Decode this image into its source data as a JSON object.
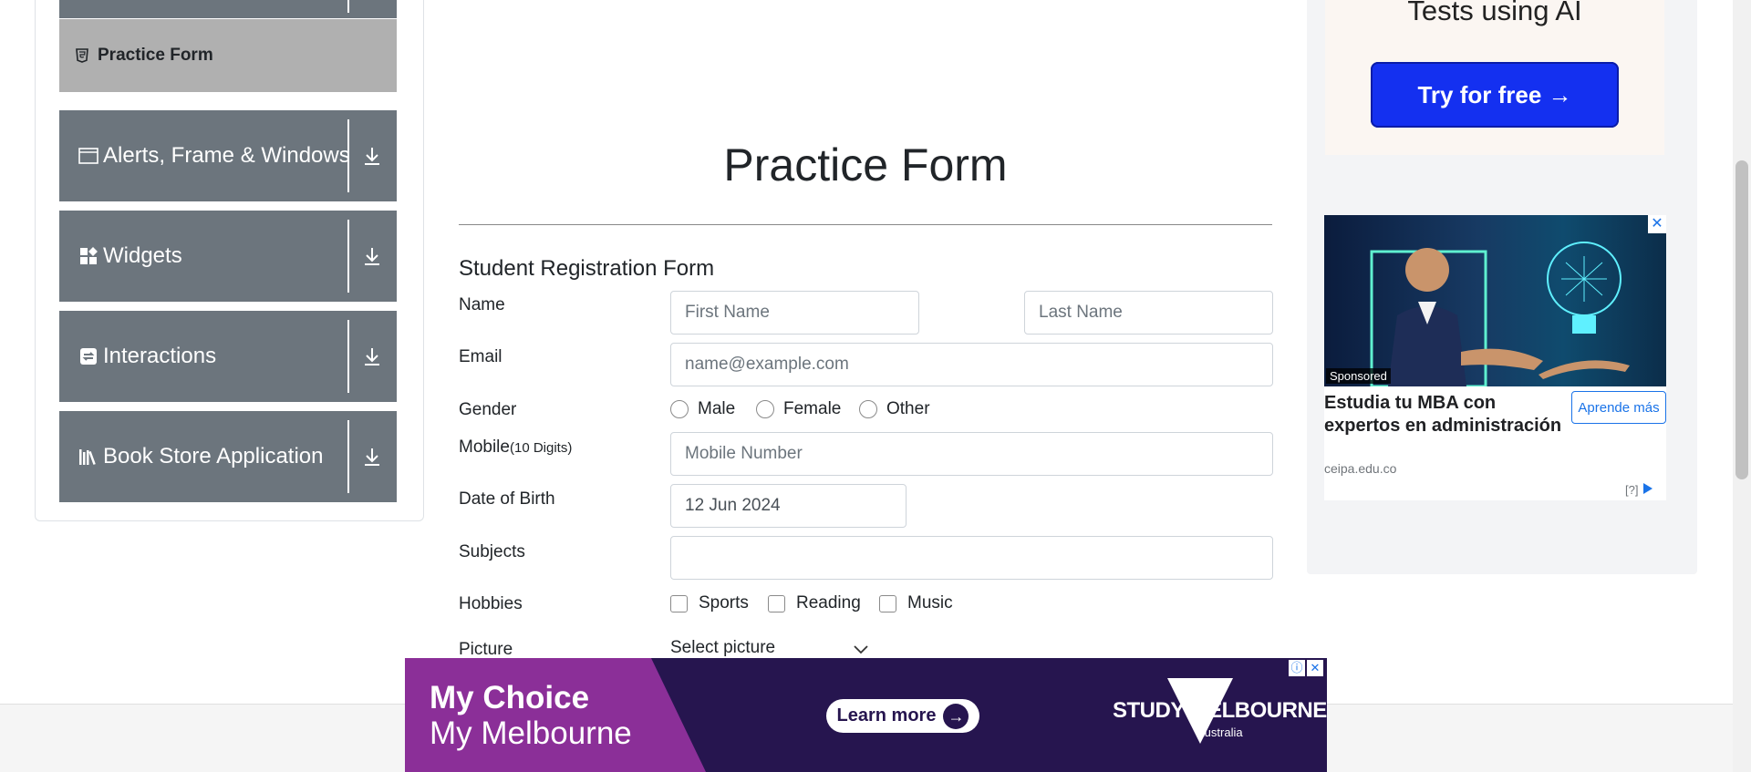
{
  "sidebar": {
    "active_item": {
      "label": "Practice Form",
      "icon": "html5-icon"
    },
    "groups": [
      {
        "label": "Alerts, Frame & Windows",
        "icon": "window-icon"
      },
      {
        "label": "Widgets",
        "icon": "widgets-icon"
      },
      {
        "label": "Interactions",
        "icon": "interactions-icon"
      },
      {
        "label": "Book Store Application",
        "icon": "books-icon"
      }
    ]
  },
  "main": {
    "page_title": "Practice Form",
    "form_heading": "Student Registration Form",
    "name": {
      "label": "Name",
      "first_placeholder": "First Name",
      "last_placeholder": "Last Name"
    },
    "email": {
      "label": "Email",
      "placeholder": "name@example.com"
    },
    "gender": {
      "label": "Gender",
      "options": [
        "Male",
        "Female",
        "Other"
      ]
    },
    "mobile": {
      "label": "Mobile",
      "hint": "(10 Digits)",
      "placeholder": "Mobile Number"
    },
    "dob": {
      "label": "Date of Birth",
      "value": "12 Jun 2024"
    },
    "subjects": {
      "label": "Subjects",
      "value": ""
    },
    "hobbies": {
      "label": "Hobbies",
      "options": [
        "Sports",
        "Reading",
        "Music"
      ]
    },
    "picture": {
      "label": "Picture",
      "select_label": "Select picture"
    }
  },
  "ads": {
    "top": {
      "headline": "Tests using AI",
      "button": "Try for free →"
    },
    "card": {
      "sponsored": "Sponsored",
      "title": "Estudia tu MBA con expertos en administración",
      "domain": "ceipa.edu.co",
      "button": "Aprende más",
      "info": "[?]"
    },
    "bottom": {
      "line1": "My Choice",
      "line2": "My Melbourne",
      "button": "Learn more",
      "logo": "STUDY MELBOURNE",
      "logo_sub": "Australia"
    }
  },
  "colors": {
    "sidebar_group": "#6c757d",
    "active_item": "#b0b0b0",
    "try_button": "#1430f0",
    "ad_link": "#1a73e8",
    "banner_purple": "#8b2f98",
    "banner_navy": "#26154f"
  }
}
